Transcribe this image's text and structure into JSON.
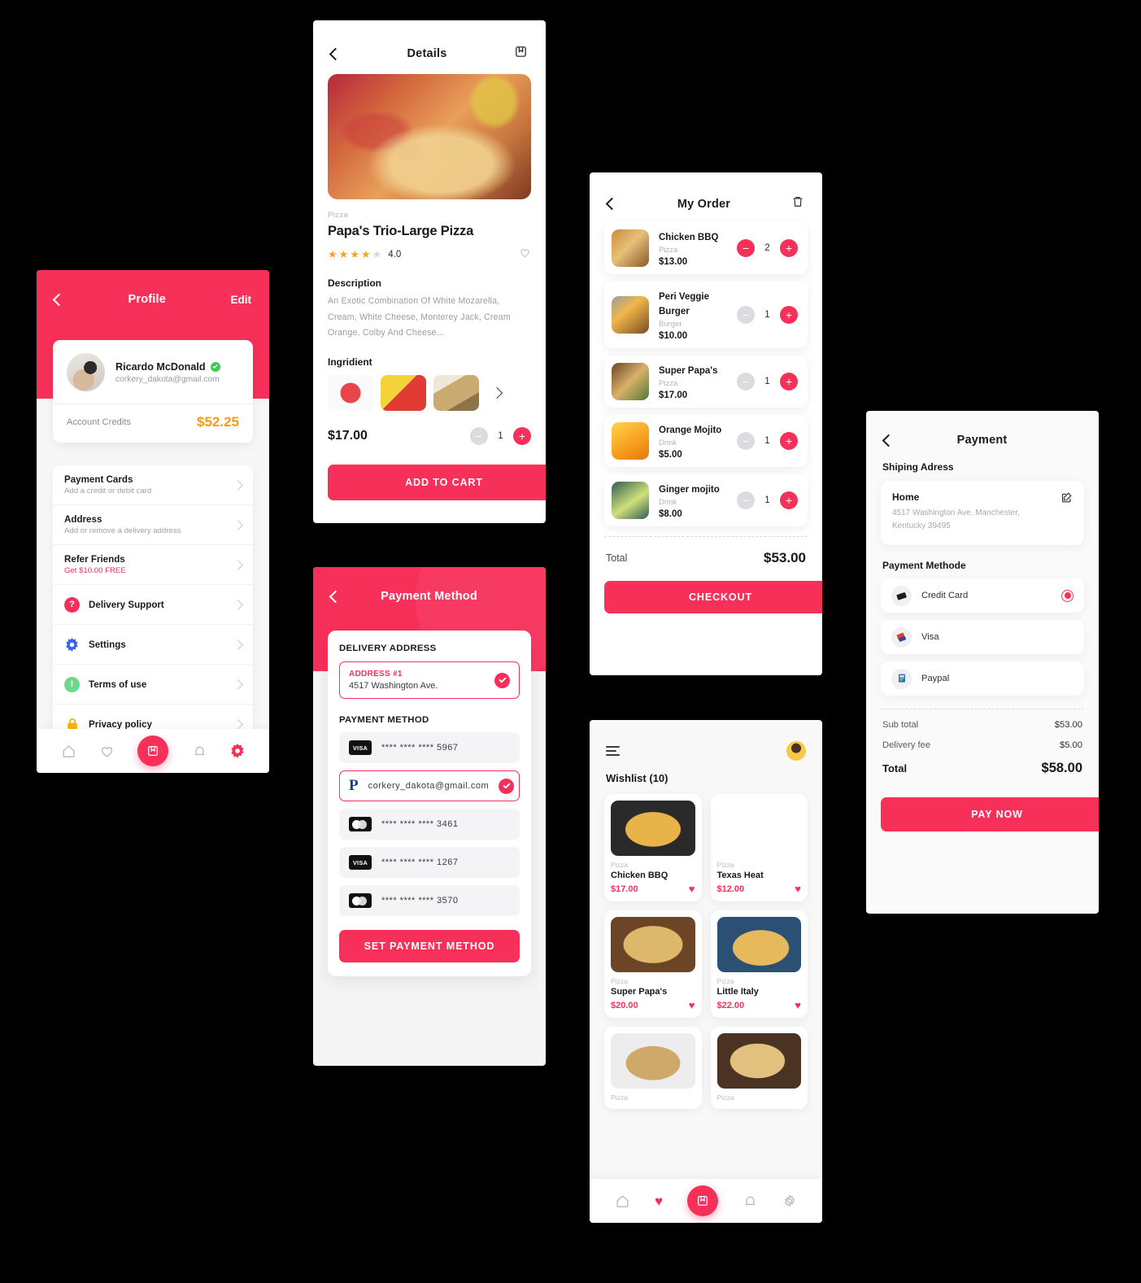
{
  "theme": {
    "accent": "#F7305A",
    "credit_amber": "#F79B10",
    "star": "#F7A41D"
  },
  "profile_screen": {
    "header": {
      "title": "Profile",
      "edit_label": "Edit",
      "back_icon": "chevron-left-icon"
    },
    "user": {
      "name": "Ricardo McDonald",
      "email": "corkery_dakota@gmail.com",
      "verified_icon": "verified-check-icon"
    },
    "credits": {
      "label": "Account Credits",
      "amount": "$52.25"
    },
    "menu": [
      {
        "title": "Payment Cards",
        "subtitle": "Add a credit or debit card",
        "icon": null
      },
      {
        "title": "Address",
        "subtitle": "Add or remove a delivery address",
        "icon": null
      },
      {
        "title": "Refer Friends",
        "subtitle": "Get $10.00 FREE",
        "subtitle_accent": true,
        "icon": null
      },
      {
        "title": "Delivery Support",
        "subtitle": null,
        "icon": "question-mark-icon"
      },
      {
        "title": "Settings",
        "subtitle": null,
        "icon": "gear-icon"
      },
      {
        "title": "Terms of use",
        "subtitle": null,
        "icon": "exclamation-icon"
      },
      {
        "title": "Privacy policy",
        "subtitle": null,
        "icon": "lock-icon"
      }
    ],
    "nav": [
      {
        "name": "home-icon",
        "active": false
      },
      {
        "name": "heart-icon",
        "active": false
      },
      {
        "name": "bag-icon",
        "active": true
      },
      {
        "name": "bell-icon",
        "active": false
      },
      {
        "name": "gear-icon",
        "active": true
      }
    ]
  },
  "details_screen": {
    "header": {
      "title": "Details",
      "back_icon": "chevron-left-icon",
      "bookmark_icon": "save-bag-icon"
    },
    "product": {
      "category": "Pizza",
      "name": "Papa's Trio-Large Pizza",
      "rating_value": "4.0",
      "stars_filled": 4,
      "stars_total": 5,
      "favorite_icon": "heart-outline-icon",
      "description_label": "Description",
      "description": "An Exotic Combination Of White Mozarella, Cream, White Cheese, Monterey Jack, Cream Orange, Colby And Cheese...",
      "ingredient_label": "Ingridient",
      "ingredients": [
        "tomato",
        "peppers",
        "mushrooms"
      ],
      "more_icon": "chevron-right-icon",
      "price": "$17.00",
      "quantity": "1",
      "cta_label": "ADD TO CART"
    }
  },
  "payment_method_screen": {
    "header": {
      "title": "Payment Method",
      "back_icon": "chevron-left-icon"
    },
    "delivery_address_label": "DELIVERY ADDRESS",
    "address": {
      "tag": "ADDRESS #1",
      "line": "4517 Washington Ave.",
      "selected": true
    },
    "payment_method_label": "PAYMENT METHOD",
    "methods": [
      {
        "brand": "visa",
        "label": "**** **** **** 5967",
        "selected": false
      },
      {
        "brand": "paypal",
        "label": "corkery_dakota@gmail.com",
        "selected": true
      },
      {
        "brand": "mastercard",
        "label": "**** **** **** 3461",
        "selected": false
      },
      {
        "brand": "visa",
        "label": "**** **** **** 1267",
        "selected": false
      },
      {
        "brand": "mastercard",
        "label": "**** **** **** 3570",
        "selected": false
      }
    ],
    "cta_label": "SET PAYMENT METHOD"
  },
  "my_order_screen": {
    "header": {
      "title": "My Order",
      "back_icon": "chevron-left-icon",
      "delete_icon": "trash-icon"
    },
    "items": [
      {
        "name": "Chicken BBQ",
        "category": "Pizza",
        "price": "$13.00",
        "qty": "2",
        "minus_active": true
      },
      {
        "name": "Peri Veggie Burger",
        "category": "Burger",
        "price": "$10.00",
        "qty": "1",
        "minus_active": false
      },
      {
        "name": "Super Papa's",
        "category": "Pizza",
        "price": "$17.00",
        "qty": "1",
        "minus_active": false
      },
      {
        "name": "Orange Mojito",
        "category": "Drink",
        "price": "$5.00",
        "qty": "1",
        "minus_active": false
      },
      {
        "name": "Ginger mojito",
        "category": "Drink",
        "price": "$8.00",
        "qty": "1",
        "minus_active": false
      }
    ],
    "total_label": "Total",
    "total_value": "$53.00",
    "cta_label": "CHECKOUT"
  },
  "wishlist_screen": {
    "header": {
      "menu_icon": "hamburger-icon",
      "avatar_icon": "user-avatar"
    },
    "title": "Wishlist (10)",
    "items": [
      {
        "category": "Pizza",
        "name": "Chicken BBQ",
        "price": "$17.00",
        "favorite": true
      },
      {
        "category": "Pizza",
        "name": "Texas Heat",
        "price": "$12.00",
        "favorite": true
      },
      {
        "category": "Pizza",
        "name": "Super Papa's",
        "price": "$20.00",
        "favorite": true
      },
      {
        "category": "Pizza",
        "name": "Little Italy",
        "price": "$22.00",
        "favorite": true
      },
      {
        "category": "Pizza",
        "name": "",
        "price": "",
        "favorite": false
      },
      {
        "category": "Pizza",
        "name": "",
        "price": "",
        "favorite": false
      }
    ],
    "nav": [
      {
        "name": "home-icon",
        "active": false
      },
      {
        "name": "heart-icon",
        "active": true
      },
      {
        "name": "bag-icon",
        "active": true
      },
      {
        "name": "bell-icon",
        "active": false
      },
      {
        "name": "gear-icon",
        "active": false
      }
    ]
  },
  "payment_screen": {
    "header": {
      "title": "Payment",
      "back_icon": "chevron-left-icon"
    },
    "shipping_label": "Shiping Adress",
    "address": {
      "name": "Home",
      "line": "4517 Washington Ave. Manchester, Kentucky 39495",
      "edit_icon": "edit-square-icon"
    },
    "payment_method_label": "Payment Methode",
    "methods": [
      {
        "label": "Credit Card",
        "icon": "credit-card-icon",
        "selected": true
      },
      {
        "label": "Visa",
        "icon": "visa-card-icon",
        "selected": false
      },
      {
        "label": "Paypal",
        "icon": "paypal-icon",
        "selected": false
      }
    ],
    "summary": [
      {
        "label": "Sub total",
        "value": "$53.00",
        "grand": false
      },
      {
        "label": "Delivery fee",
        "value": "$5.00",
        "grand": false
      },
      {
        "label": "Total",
        "value": "$58.00",
        "grand": true
      }
    ],
    "cta_label": "PAY NOW"
  }
}
